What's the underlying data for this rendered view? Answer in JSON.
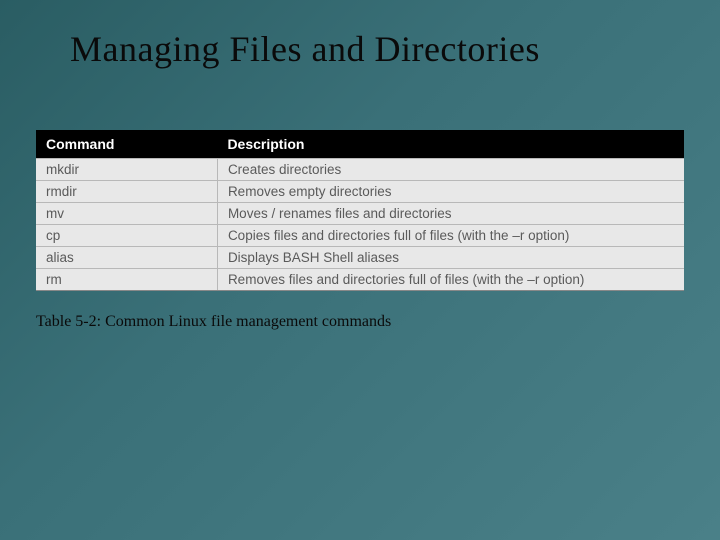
{
  "title": "Managing Files and Directories",
  "table": {
    "headers": {
      "col1": "Command",
      "col2": "Description"
    },
    "rows": [
      {
        "cmd": "mkdir",
        "desc": "Creates directories"
      },
      {
        "cmd": "rmdir",
        "desc": "Removes empty directories"
      },
      {
        "cmd": "mv",
        "desc": "Moves / renames files and directories"
      },
      {
        "cmd": "cp",
        "desc": "Copies files and directories full of files (with the –r option)"
      },
      {
        "cmd": "alias",
        "desc": "Displays BASH Shell aliases"
      },
      {
        "cmd": "rm",
        "desc": "Removes files and directories full of files (with the –r option)"
      }
    ]
  },
  "caption": "Table 5-2: Common Linux file management commands"
}
